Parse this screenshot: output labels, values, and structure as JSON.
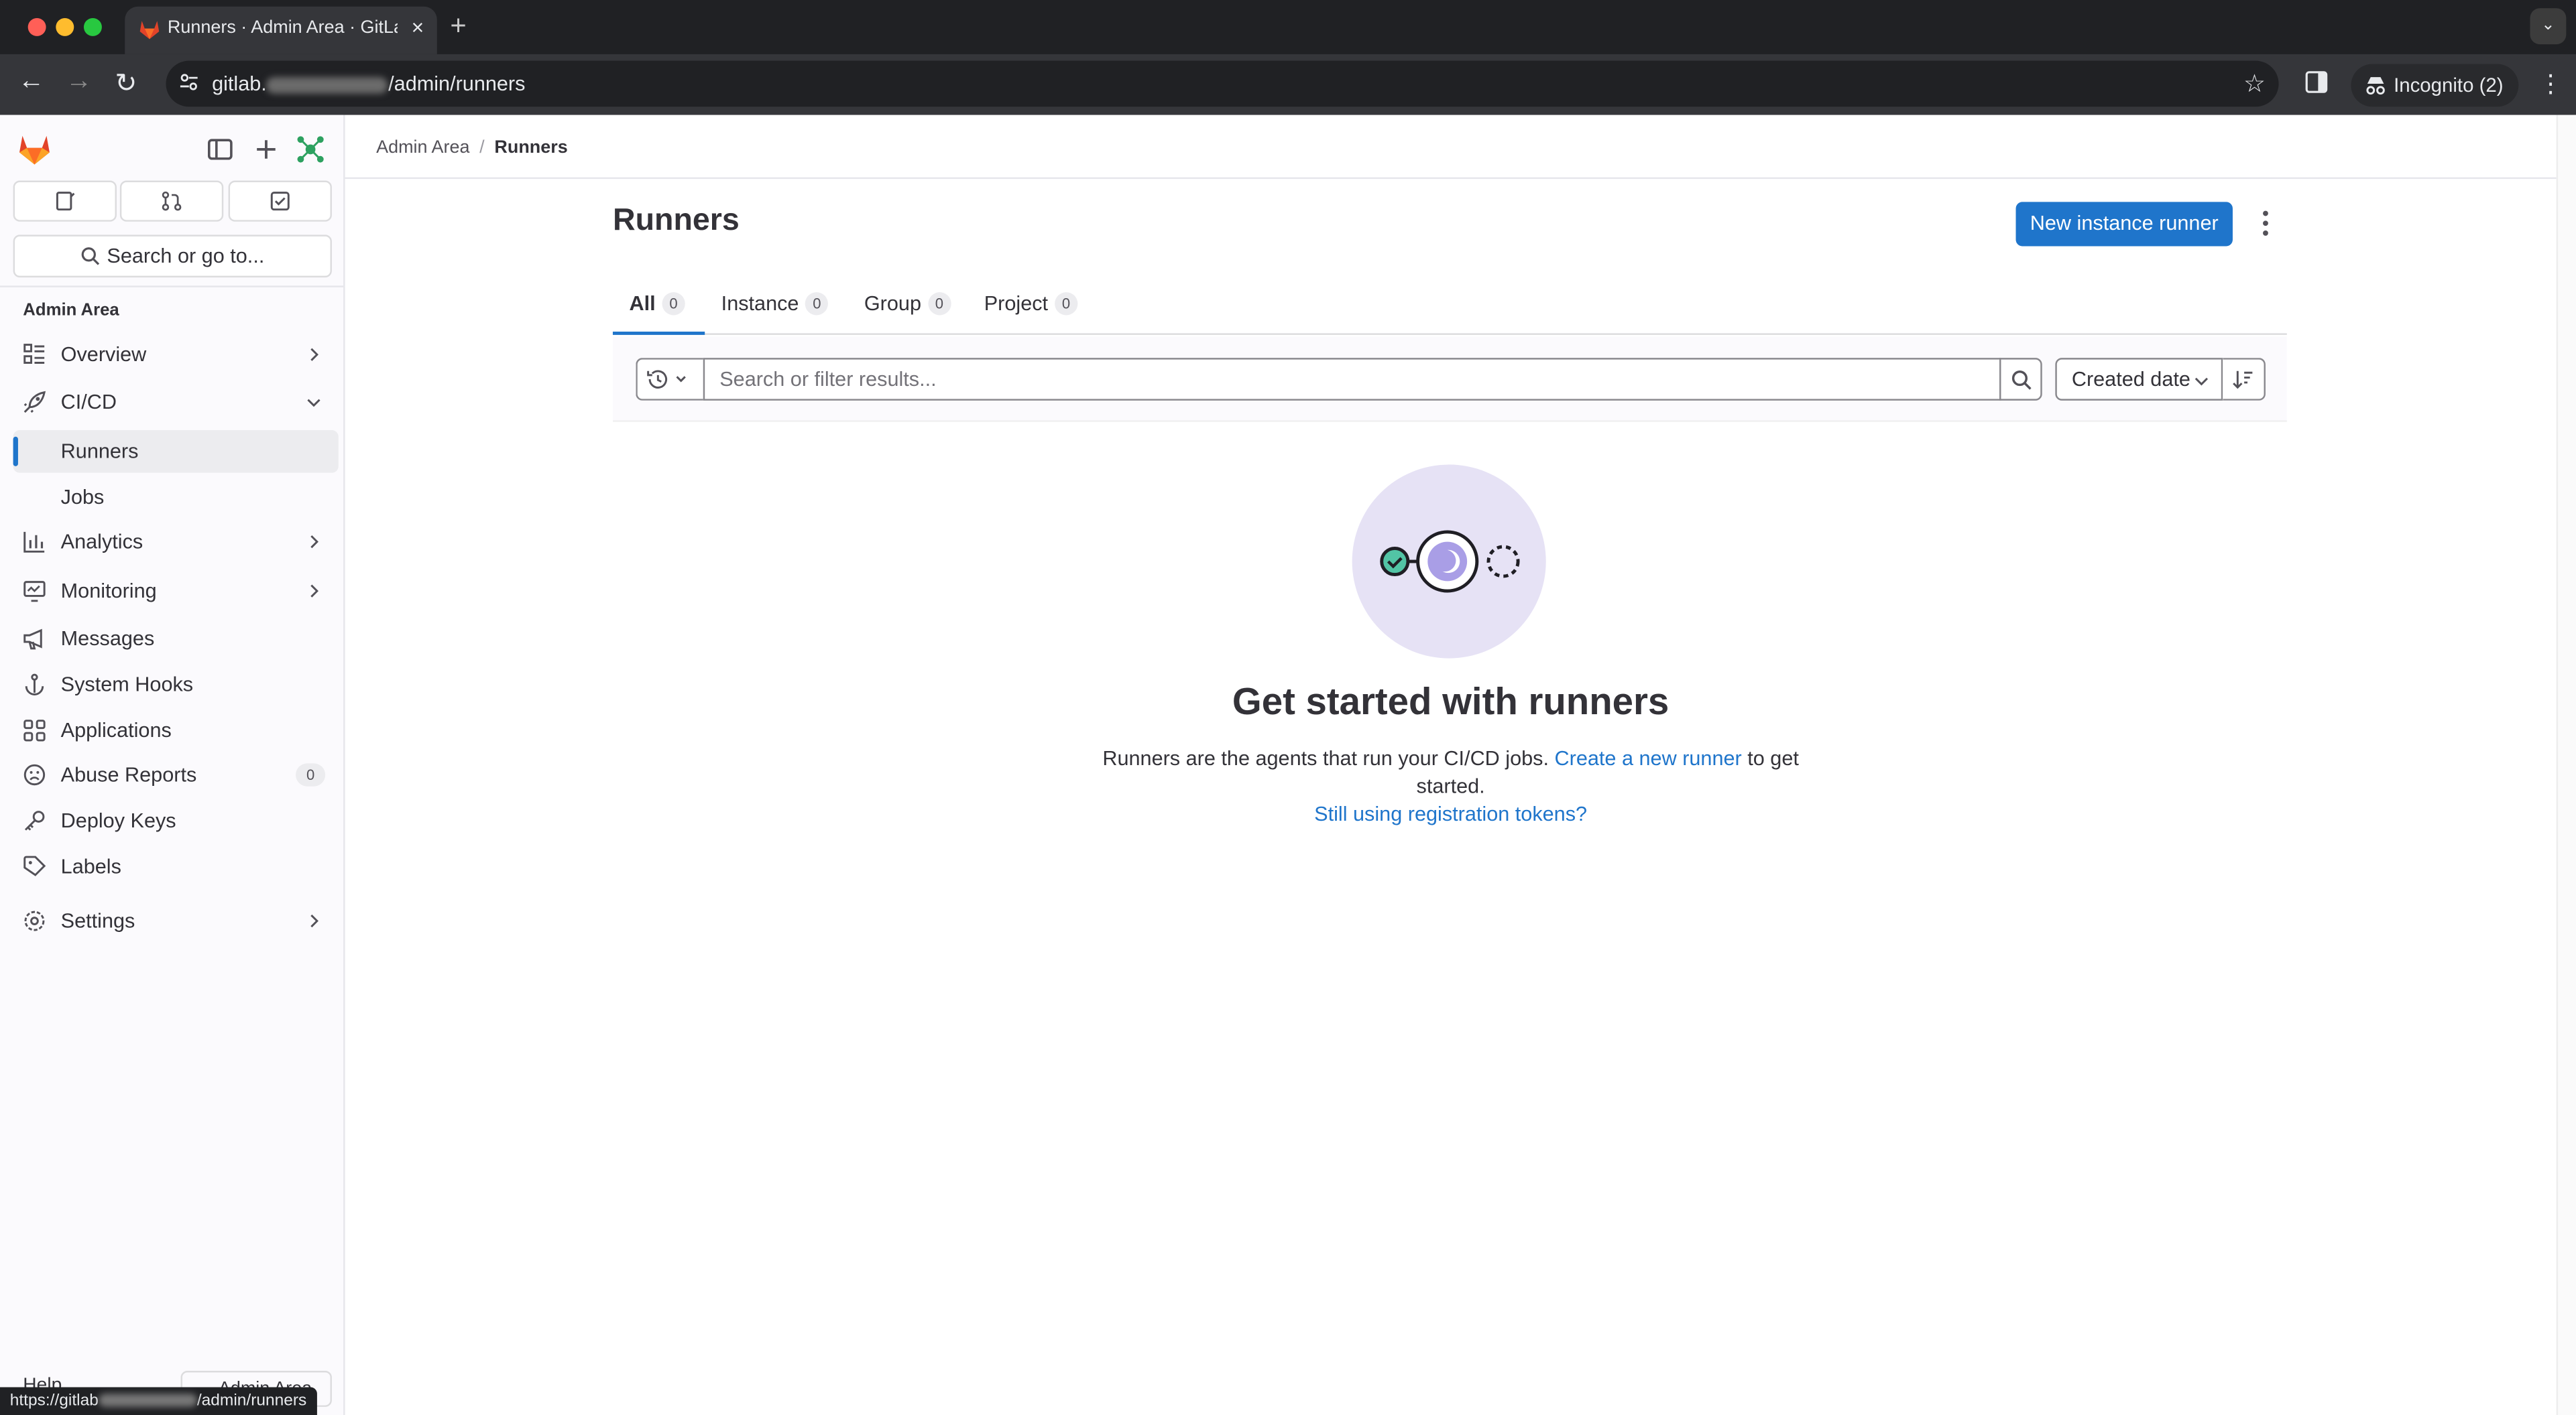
{
  "browser": {
    "tab_title": "Runners · Admin Area · GitLab",
    "url_prefix": "gitlab.",
    "url_suffix": "/admin/runners",
    "incognito_label": "Incognito (2)",
    "status_url_prefix": "https://gitlab",
    "status_url_suffix": "/admin/runners"
  },
  "sidebar": {
    "search_placeholder": "Search or go to...",
    "context_title": "Admin Area",
    "items": [
      {
        "label": "Overview",
        "icon": "overview-icon",
        "expandable": true
      },
      {
        "label": "CI/CD",
        "icon": "rocket-icon",
        "expanded": true
      },
      {
        "label": "Runners",
        "active": true
      },
      {
        "label": "Jobs"
      },
      {
        "label": "Analytics",
        "icon": "chart-icon",
        "expandable": true
      },
      {
        "label": "Monitoring",
        "icon": "monitor-icon",
        "expandable": true
      },
      {
        "label": "Messages",
        "icon": "bullhorn-icon"
      },
      {
        "label": "System Hooks",
        "icon": "hook-icon"
      },
      {
        "label": "Applications",
        "icon": "applications-icon"
      },
      {
        "label": "Abuse Reports",
        "icon": "abuse-icon",
        "count": "0"
      },
      {
        "label": "Deploy Keys",
        "icon": "key-icon"
      },
      {
        "label": "Labels",
        "icon": "label-icon"
      },
      {
        "label": "Settings",
        "icon": "settings-icon",
        "expandable": true
      }
    ],
    "footer_help": "Help",
    "footer_admin": "Admin Area"
  },
  "breadcrumb": {
    "parent": "Admin Area",
    "current": "Runners"
  },
  "page": {
    "title": "Runners",
    "new_button": "New instance runner",
    "tabs": [
      {
        "label": "All",
        "count": "0",
        "active": true
      },
      {
        "label": "Instance",
        "count": "0"
      },
      {
        "label": "Group",
        "count": "0"
      },
      {
        "label": "Project",
        "count": "0"
      }
    ],
    "search_placeholder": "Search or filter results...",
    "sort_label": "Created date",
    "empty": {
      "title": "Get started with runners",
      "desc_before": "Runners are the agents that run your CI/CD jobs. ",
      "desc_link": "Create a new runner",
      "desc_after": " to get started.",
      "link2": "Still using registration tokens?"
    }
  },
  "colors": {
    "accent": "#1f75cb",
    "illustration_bg": "#e6e2f5",
    "success": "#52c4a5"
  }
}
